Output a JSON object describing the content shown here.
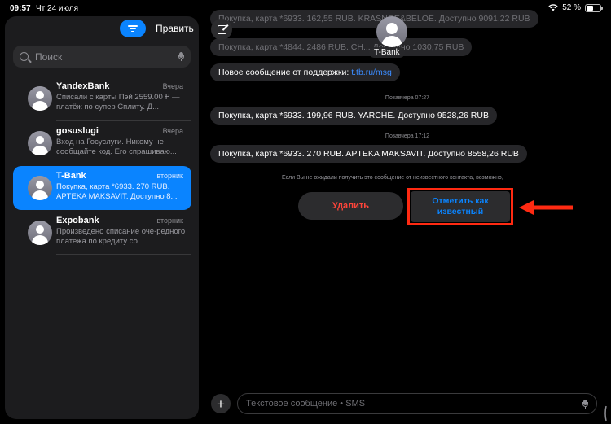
{
  "status_bar": {
    "time": "09:57",
    "date": "Чт 24 июля",
    "battery": "52 %",
    "battery_level": 0.52
  },
  "sidebar": {
    "edit_label": "Править",
    "search_placeholder": "Поиск",
    "conversations": [
      {
        "name": "YandexBank",
        "time": "Вчера",
        "preview": "Списали с карты Пэй 2559.00 ₽ — платёж по супер Сплиту. Д...",
        "selected": false
      },
      {
        "name": "gosuslugi",
        "time": "Вчера",
        "preview": "Вход на Госуслуги. Никому не сообщайте код. Его спрашиваю...",
        "selected": false
      },
      {
        "name": "T-Bank",
        "time": "вторник",
        "preview": "Покупка, карта *6933. 270 RUB. APTEKA MAKSAVIT. Доступно 8...",
        "selected": true
      },
      {
        "name": "Expobank",
        "time": "вторник",
        "preview": "Произведено списание оче-редного платежа по кредиту со...",
        "selected": false
      }
    ]
  },
  "chat": {
    "contact_name": "T-Bank",
    "messages_top": [
      {
        "text": "Покупка, карта *6933. 162,55 RUB. KRASNOE&BELOE. Доступно 9091,22 RUB",
        "faded": true
      },
      {
        "text": "Покупка, карта *4844. 2486 RUB. CH... Доступно 1030,75 RUB",
        "faded": true
      }
    ],
    "support_message_text": "Новое сообщение от поддержки: ",
    "support_link": "t.tb.ru/msg",
    "stamp_1": "Позавчера 07:27",
    "message_2": "Покупка, карта *6933. 199,96 RUB. YARCHE. Доступно 9528,26 RUB",
    "stamp_2": "Позавчера 17:12",
    "message_3": "Покупка, карта *6933. 270 RUB. APTEKA MAKSAVIT. Доступно 8558,26 RUB",
    "unknown_notice": "Если Вы не ожидали получить это сообщение от неизвестного контакта, возможно,",
    "delete_label": "Удалить",
    "mark_known_line1": "Отметить как",
    "mark_known_line2": "известный",
    "input_placeholder": "Текстовое сообщение • SMS"
  },
  "colors": {
    "accent": "#0a84ff",
    "danger": "#ff453a",
    "highlight_frame": "#ff2a12"
  }
}
